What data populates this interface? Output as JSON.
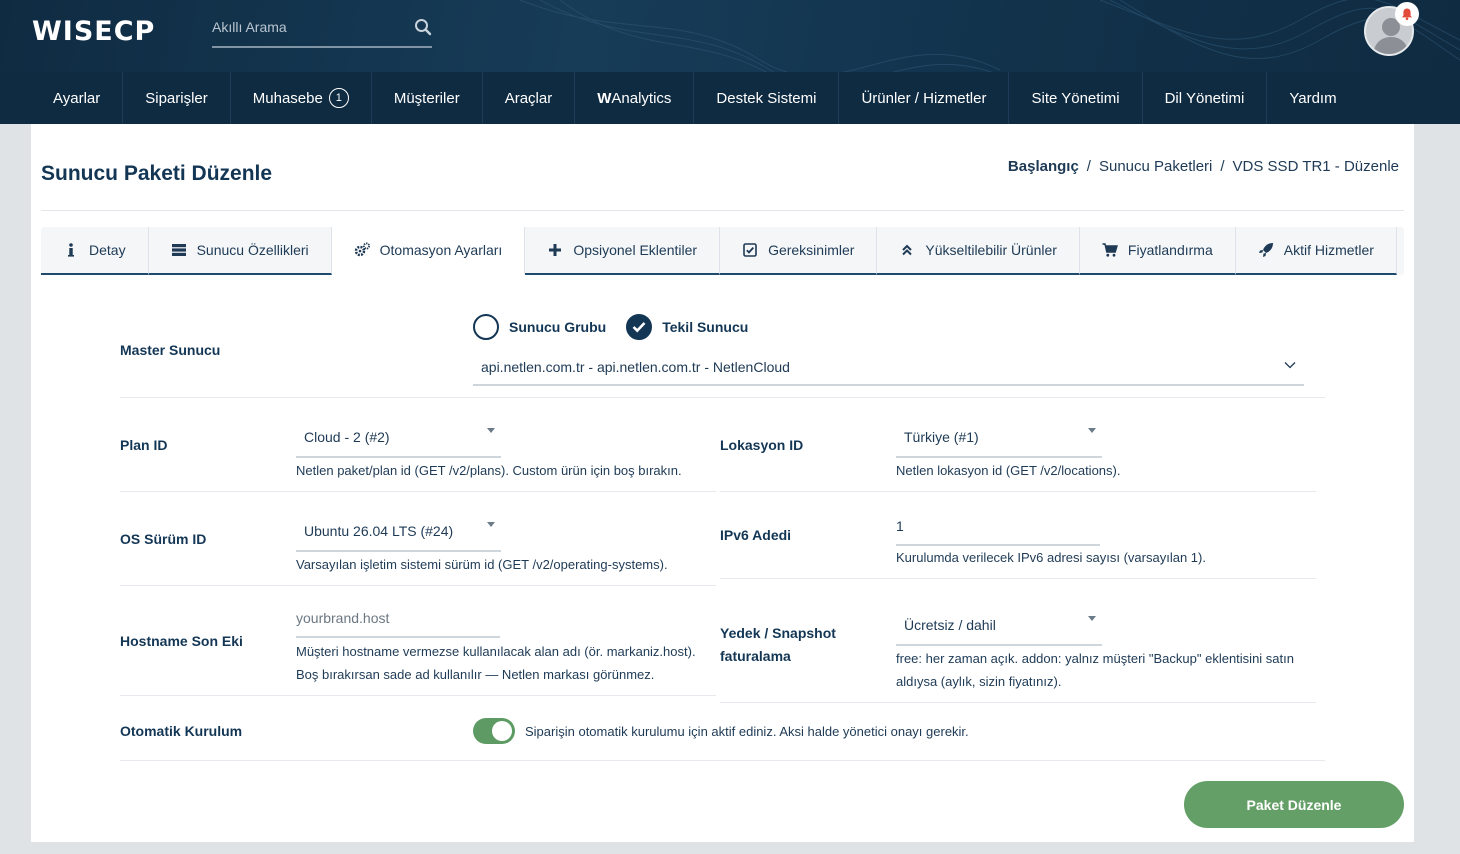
{
  "app": {
    "logo": "WISECP",
    "search_placeholder": "Akıllı Arama"
  },
  "nav": {
    "items": [
      {
        "label": "Ayarlar"
      },
      {
        "label": "Siparişler"
      },
      {
        "label": "Muhasebe",
        "badge": "1"
      },
      {
        "label": "Müşteriler"
      },
      {
        "label": "Araçlar"
      },
      {
        "label_bold": "W",
        "label": "Analytics"
      },
      {
        "label": "Destek Sistemi"
      },
      {
        "label": "Ürünler / Hizmetler"
      },
      {
        "label": "Site Yönetimi"
      },
      {
        "label": "Dil Yönetimi"
      },
      {
        "label": "Yardım"
      }
    ]
  },
  "page": {
    "title": "Sunucu Paketi Düzenle",
    "breadcrumb": [
      "Başlangıç",
      "/",
      "Sunucu Paketleri",
      "/",
      "VDS SSD TR1 - Düzenle"
    ]
  },
  "tabs": [
    {
      "label": "Detay",
      "icon": "info-icon"
    },
    {
      "label": "Sunucu Özellikleri",
      "icon": "server-icon"
    },
    {
      "label": "Otomasyon Ayarları",
      "icon": "gears-icon",
      "active": true
    },
    {
      "label": "Opsiyonel Eklentiler",
      "icon": "plus-icon"
    },
    {
      "label": "Gereksinimler",
      "icon": "checkbox-icon"
    },
    {
      "label": "Yükseltilebilir Ürünler",
      "icon": "double-chevron-up-icon"
    },
    {
      "label": "Fiyatlandırma",
      "icon": "cart-icon"
    },
    {
      "label": "Aktif Hizmetler",
      "icon": "rocket-icon"
    }
  ],
  "form": {
    "master": {
      "label": "Master Sunucu",
      "radio_group": "Sunucu Grubu",
      "radio_single": "Tekil Sunucu",
      "selected": "Tekil Sunucu",
      "server_value": "api.netlen.com.tr - api.netlen.com.tr - NetlenCloud"
    },
    "plan": {
      "label": "Plan ID",
      "value": "Cloud - 2 (#2)",
      "hint": "Netlen paket/plan id (GET /v2/plans). Custom ürün için boş bırakın."
    },
    "location": {
      "label": "Lokasyon ID",
      "value": "Türkiye (#1)",
      "hint": "Netlen lokasyon id (GET /v2/locations)."
    },
    "os": {
      "label": "OS Sürüm ID",
      "value": "Ubuntu 26.04 LTS (#24)",
      "hint": "Varsayılan işletim sistemi sürüm id (GET /v2/operating-systems)."
    },
    "ipv6": {
      "label": "IPv6 Adedi",
      "value": "1",
      "hint": "Kurulumda verilecek IPv6 adresi sayısı (varsayılan 1)."
    },
    "hostname": {
      "label": "Hostname Son Eki",
      "placeholder": "yourbrand.host",
      "hint_line1": "Müşteri hostname vermezse kullanılacak alan adı (ör. markaniz.host).",
      "hint_line2": "Boş bırakırsan sade ad kullanılır — Netlen markası görünmez."
    },
    "backup": {
      "label_line1": "Yedek / Snapshot",
      "label_line2": "faturalama",
      "value": "Ücretsiz / dahil",
      "hint_line1": "free: her zaman açık. addon: yalnız müşteri \"Backup\" eklentisini satın",
      "hint_line2": "aldıysa (aylık, sizin fiyatınız)."
    },
    "auto": {
      "label": "Otomatik Kurulum",
      "enabled": true,
      "hint": "Siparişin otomatik kurulumu için aktif ediniz. Aksi halde yönetici onayı gerekir."
    },
    "submit_label": "Paket Düzenle"
  },
  "colors": {
    "header": "#0f2b42",
    "accent": "#133655",
    "success": "#649f67"
  }
}
